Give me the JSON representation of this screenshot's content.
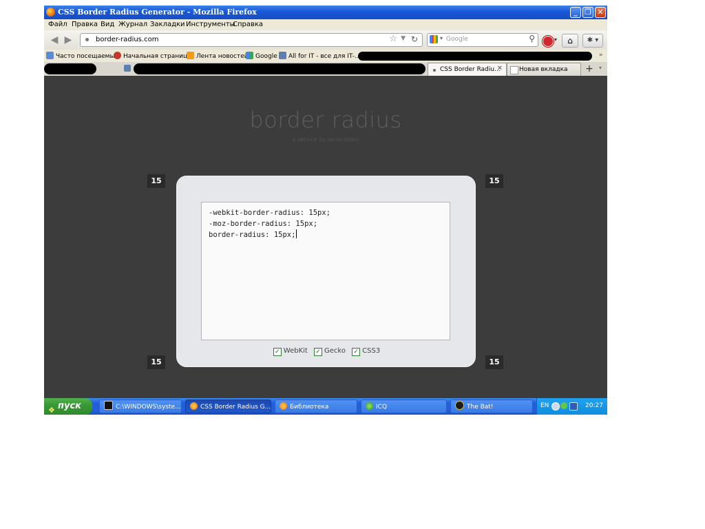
{
  "window": {
    "title": "CSS Border Radius Generator - Mozilla Firefox"
  },
  "menu": [
    "Файл",
    "Правка",
    "Вид",
    "Журнал",
    "Закладки",
    "Инструменты",
    "Справка"
  ],
  "nav": {
    "url": "border-radius.com",
    "search_placeholder": "Google"
  },
  "bookmarks": [
    "Часто посещаемые",
    "Начальная страница",
    "Лента новостей",
    "Google",
    "All for IT - все для IT-..."
  ],
  "tabs": [
    {
      "label": "CSS Border Radiu...",
      "active": true
    },
    {
      "label": "Новая вкладка",
      "active": false
    }
  ],
  "page": {
    "heading": "border radius",
    "subheading": "a service by jacob bijani",
    "corners": {
      "top_left": "15",
      "top_right": "15",
      "bottom_left": "15",
      "bottom_right": "15"
    },
    "code_lines": [
      "-webkit-border-radius: 15px;",
      "-moz-border-radius: 15px;",
      "border-radius: 15px;"
    ],
    "checkboxes": [
      {
        "label": "WebKit",
        "checked": true
      },
      {
        "label": "Gecko",
        "checked": true
      },
      {
        "label": "CSS3",
        "checked": true
      }
    ]
  },
  "taskbar": {
    "start_label": "пуск",
    "tasks": [
      {
        "label": "C:\\WINDOWS\\syste...",
        "icon": "cmd-icon",
        "active": false
      },
      {
        "label": "CSS Border Radius G...",
        "icon": "firefox-icon",
        "active": true
      },
      {
        "label": "Библиотека",
        "icon": "firefox-icon",
        "active": false
      },
      {
        "label": "ICQ",
        "icon": "icq-icon",
        "active": false
      },
      {
        "label": "The Bat!",
        "icon": "thebat-icon",
        "active": false
      }
    ],
    "lang": "EN",
    "clock": "20:27"
  }
}
